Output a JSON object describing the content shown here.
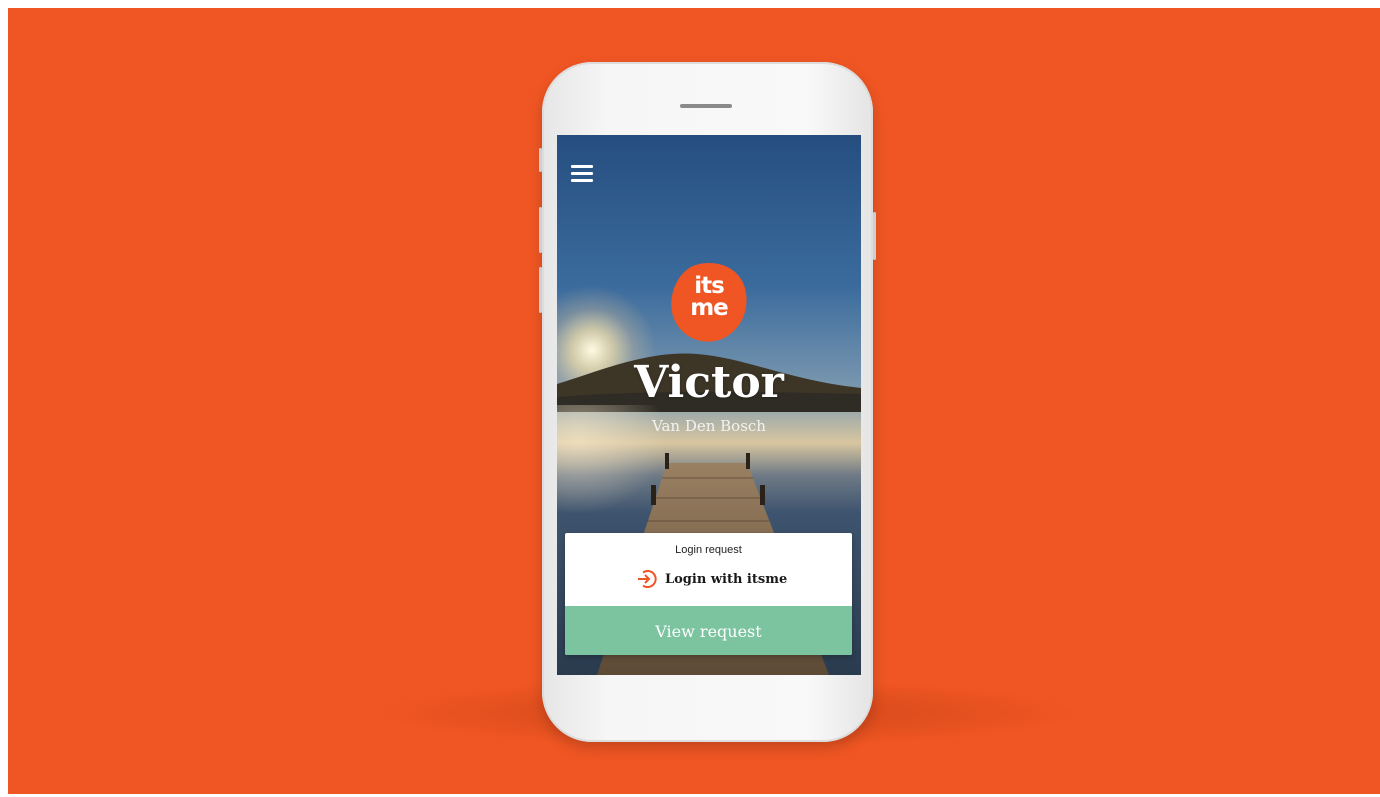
{
  "colors": {
    "background": "#f05623",
    "brand_orange": "#f05623",
    "button_green": "#7cc4a0",
    "card_bg": "#ffffff"
  },
  "app": {
    "menu_icon": "hamburger-menu-icon",
    "logo_text_line1": "its",
    "logo_text_line2": "me",
    "first_name": "Victor",
    "last_name": "Van Den Bosch"
  },
  "request_card": {
    "label": "Login request",
    "action_icon": "login-arrow-icon",
    "action_text": "Login with itsme",
    "button_label": "View request"
  }
}
